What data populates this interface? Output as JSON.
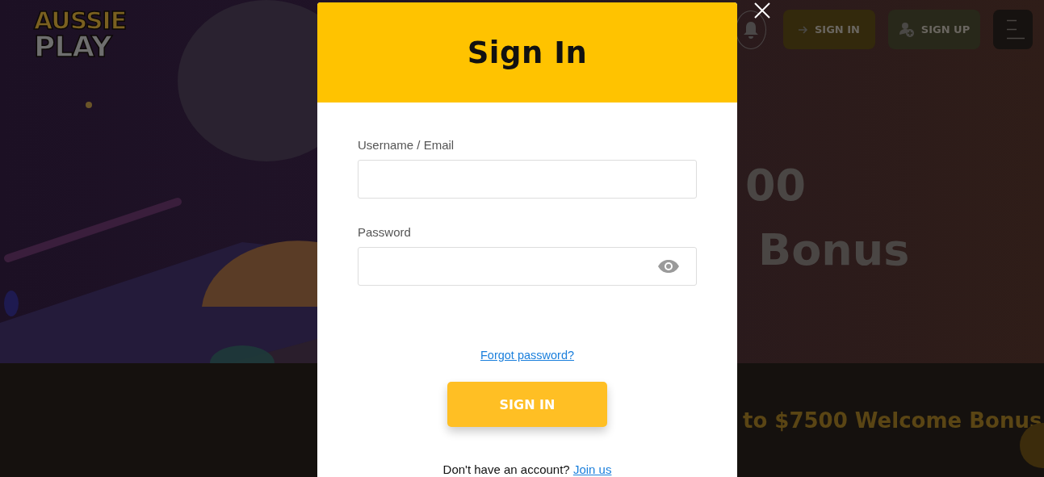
{
  "logo": {
    "lines": [
      "AUSSIE",
      "PLAY"
    ]
  },
  "header": {
    "buttons": [
      {
        "kind": "signin",
        "label": "SIGN IN"
      },
      {
        "kind": "signup",
        "label": "SIGN UP"
      }
    ]
  },
  "hero": {
    "lines": [
      "00",
      "Bonus"
    ]
  },
  "banner": {
    "text": "to $7500 Welcome Bonus"
  },
  "modal": {
    "title": "Sign In",
    "fields": [
      {
        "label": "Username / Email",
        "kind": "text"
      },
      {
        "label": "Password",
        "kind": "password"
      }
    ],
    "forgot_link": "Forgot password?",
    "submit": "SIGN IN",
    "footer": {
      "text": "Don't have an account?",
      "link": "Join us"
    }
  }
}
